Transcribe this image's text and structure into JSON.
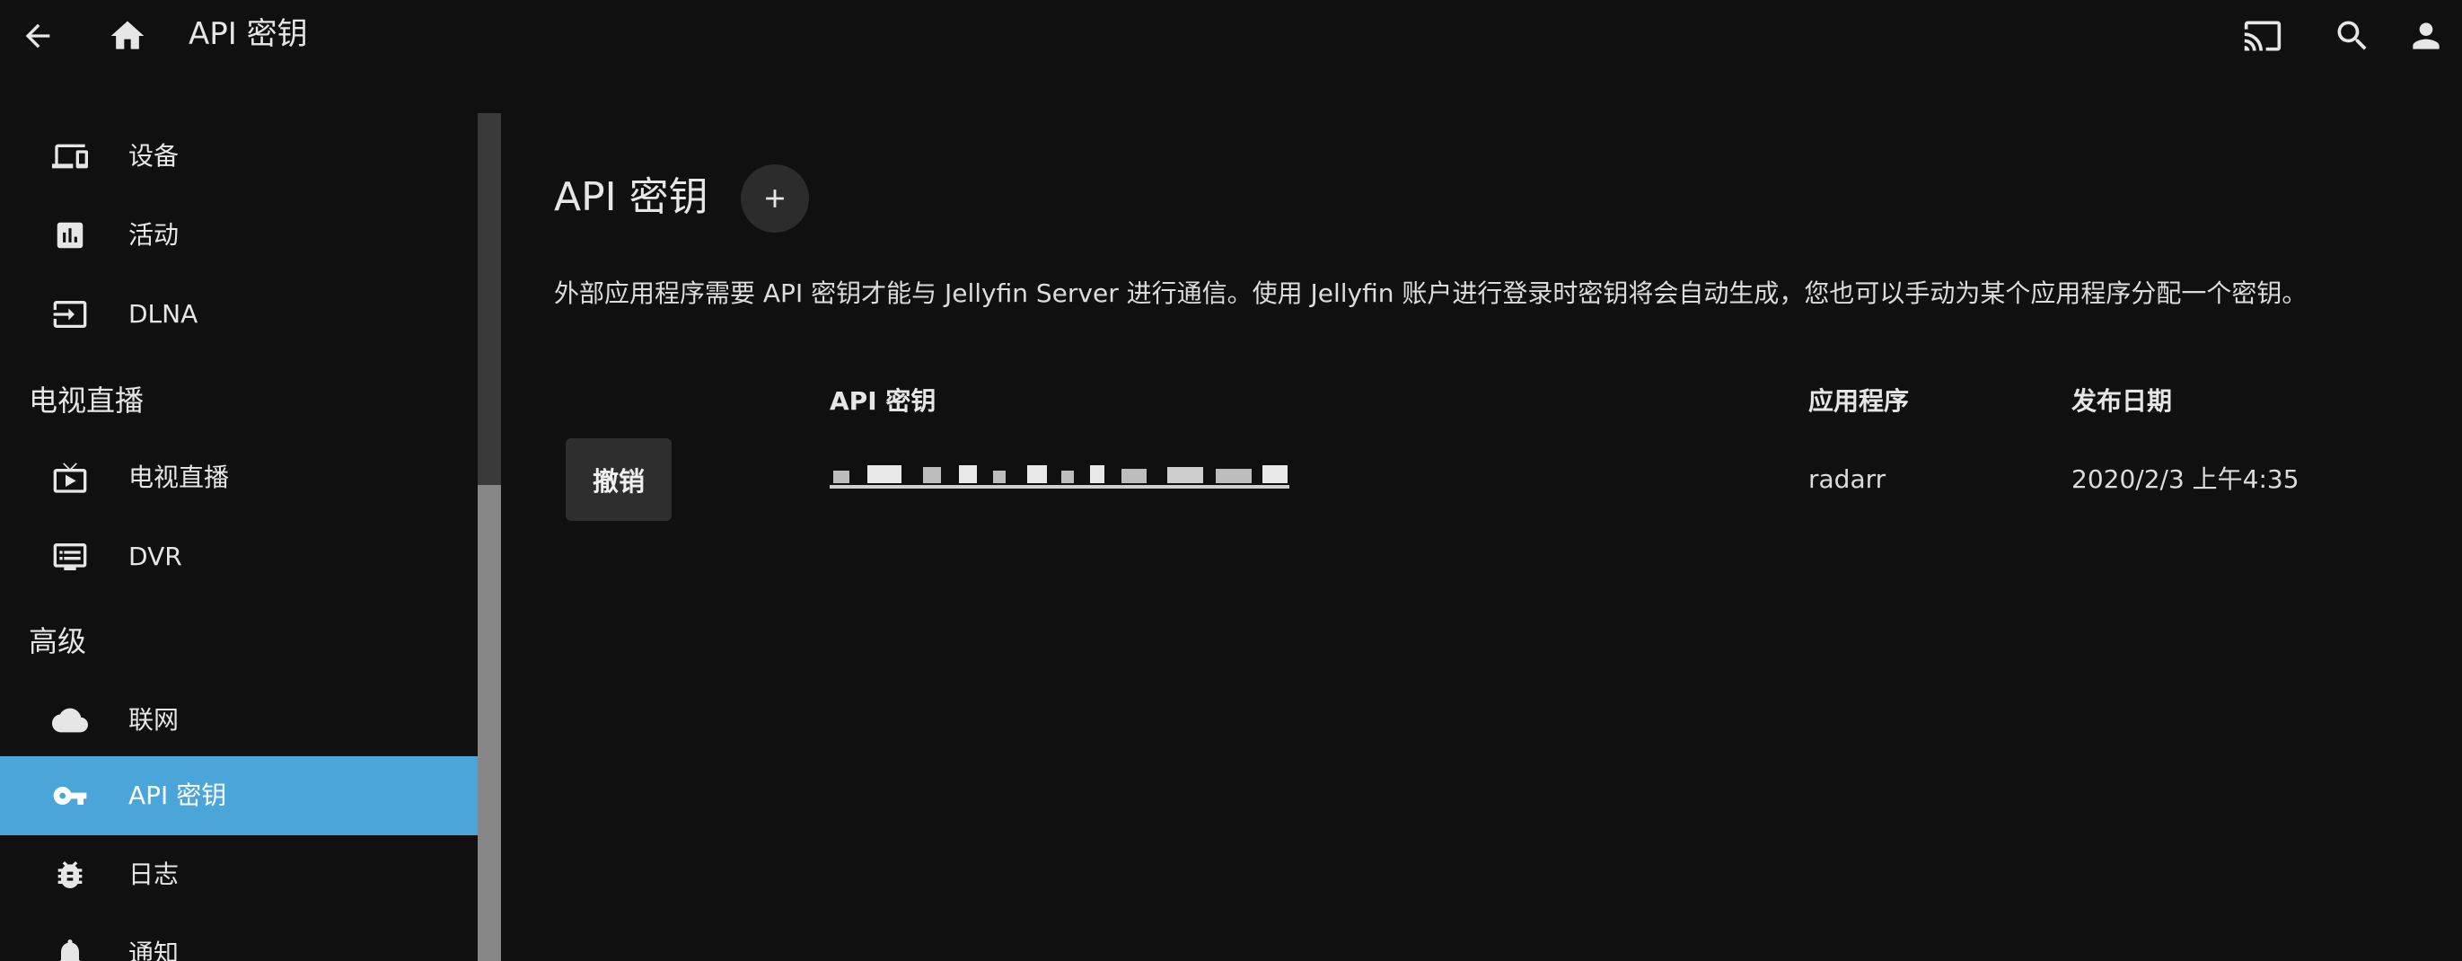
{
  "header": {
    "title": "API 密钥",
    "icons": [
      "arrow-back-icon",
      "home-icon",
      "cast-icon",
      "search-icon",
      "user-icon"
    ]
  },
  "sidebar": {
    "items_top": [
      {
        "label": "设备",
        "icon": "devices-icon"
      },
      {
        "label": "活动",
        "icon": "activity-chart-icon"
      },
      {
        "label": "DLNA",
        "icon": "input-icon"
      }
    ],
    "section_livetv": "电视直播",
    "items_livetv": [
      {
        "label": "电视直播",
        "icon": "live-tv-icon"
      },
      {
        "label": "DVR",
        "icon": "dvr-icon"
      }
    ],
    "section_advanced": "高级",
    "items_advanced": [
      {
        "label": "联网",
        "icon": "cloud-icon"
      },
      {
        "label": "API 密钥",
        "icon": "key-icon",
        "active": true
      },
      {
        "label": "日志",
        "icon": "bug-icon"
      },
      {
        "label": "通知",
        "icon": "bell-icon"
      }
    ],
    "active_color": "#4aa5d9"
  },
  "main": {
    "title": "API 密钥",
    "add_label": "+",
    "description": "外部应用程序需要 API 密钥才能与 Jellyfin Server 进行通信。使用 Jellyfin 账户进行登录时密钥将会自动生成，您也可以手动为某个应用程序分配一个密钥。",
    "table": {
      "headers": [
        "API 密钥",
        "应用程序",
        "发布日期"
      ],
      "rows": [
        {
          "action": "撤销",
          "api_key": "(redacted)",
          "app": "radarr",
          "date": "2020/2/3 上午4:35"
        }
      ]
    }
  }
}
